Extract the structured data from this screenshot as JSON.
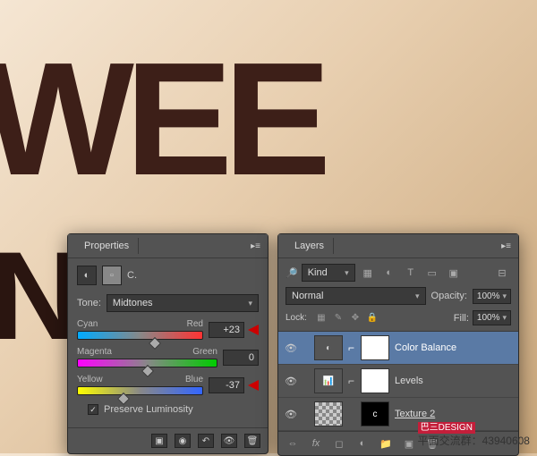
{
  "bg_text": "WEE",
  "bg_text2": "N",
  "properties": {
    "tab": "Properties",
    "title": "C.",
    "tone_label": "Tone:",
    "tone_value": "Midtones",
    "sliders": {
      "red": {
        "left": "Cyan",
        "right": "Red",
        "value": "+23",
        "pos": 62
      },
      "green": {
        "left": "Magenta",
        "right": "Green",
        "value": "0",
        "pos": 50
      },
      "blue": {
        "left": "Yellow",
        "right": "Blue",
        "value": "-37",
        "pos": 37
      }
    },
    "preserve": "Preserve Luminosity"
  },
  "layers": {
    "tab": "Layers",
    "filter_label": "Kind",
    "blend_mode": "Normal",
    "opacity_label": "Opacity:",
    "opacity_value": "100%",
    "lock_label": "Lock:",
    "fill_label": "Fill:",
    "fill_value": "100%",
    "items": [
      {
        "name": "Color Balance",
        "selected": true,
        "adj": true
      },
      {
        "name": "Levels",
        "selected": false,
        "adj": true
      },
      {
        "name": "Texture 2",
        "selected": false,
        "adj": false
      }
    ]
  },
  "watermark": {
    "brand": "巴三DESIGN",
    "text": "平面交流群：43940608"
  }
}
